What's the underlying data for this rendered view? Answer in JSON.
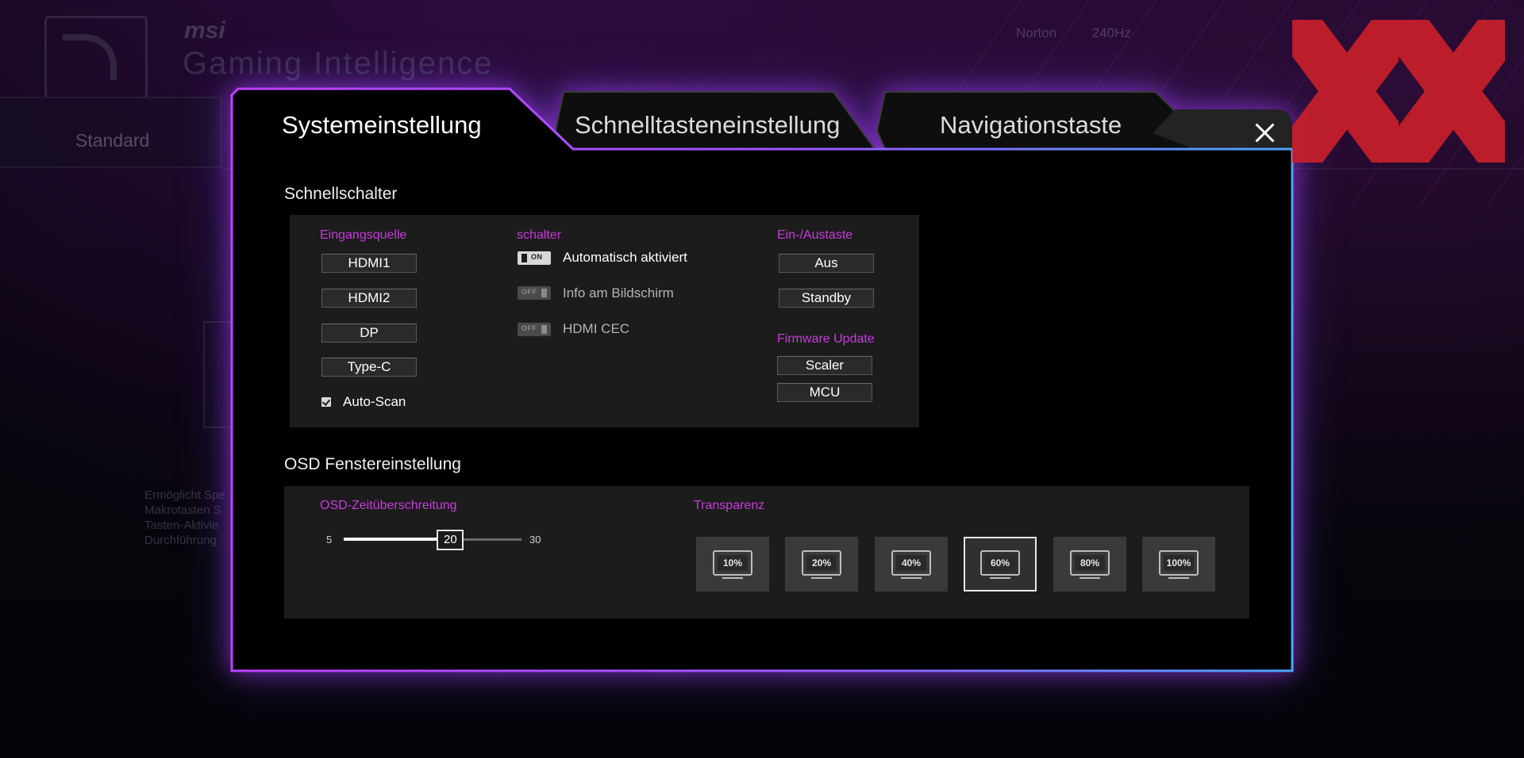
{
  "background_app": {
    "brand": "msi",
    "brand_subtitle": "Gaming Intelligence",
    "tab_standard": "Standard",
    "description_lines": [
      "Ermöglicht Spe",
      "Makrotasten S",
      "Tasten-Aktivie",
      "Durchführung"
    ],
    "top_right_items": [
      "Norton",
      "240Hz"
    ]
  },
  "dialog": {
    "tabs": [
      {
        "label": "Systemeinstellung",
        "active": true
      },
      {
        "label": "Schnelltasteneinstellung",
        "active": false
      },
      {
        "label": "Navigationstaste",
        "active": false
      }
    ],
    "quick_switch": {
      "title": "Schnellschalter",
      "input_source": {
        "label": "Eingangsquelle",
        "options": [
          "HDMI1",
          "HDMI2",
          "DP",
          "Type-C"
        ],
        "auto_scan_label": "Auto-Scan",
        "auto_scan_checked": true
      },
      "switches": {
        "label": "schalter",
        "items": [
          {
            "state_text": "ON",
            "on": true,
            "label": "Automatisch aktiviert"
          },
          {
            "state_text": "OFF",
            "on": false,
            "label": "Info am Bildschirm"
          },
          {
            "state_text": "OFF",
            "on": false,
            "label": "HDMI CEC"
          }
        ]
      },
      "power_key": {
        "label": "Ein-/Austaste",
        "options": [
          "Aus",
          "Standby"
        ]
      },
      "firmware_update": {
        "label": "Firmware Update",
        "options": [
          "Scaler",
          "MCU"
        ]
      }
    },
    "osd_window": {
      "title": "OSD Fenstereinstellung",
      "timeout": {
        "label": "OSD-Zeitüberschreitung",
        "min": "5",
        "max": "30",
        "value": "20",
        "min_num": 5,
        "max_num": 30,
        "value_num": 20
      },
      "transparency": {
        "label": "Transparenz",
        "options": [
          "10%",
          "20%",
          "40%",
          "60%",
          "80%",
          "100%"
        ],
        "selected": "60%"
      }
    }
  },
  "colors": {
    "accent_purple": "#c83cdc",
    "glow_purple": "#b43cff",
    "glow_blue": "#4aa6ff",
    "panel_bg": "#1c1c1c",
    "dialog_bg": "#000000",
    "watermark_red": "#c8202a"
  },
  "icons": {
    "close": "close-icon",
    "monitor": "monitor-icon",
    "check": "checkmark-icon"
  }
}
